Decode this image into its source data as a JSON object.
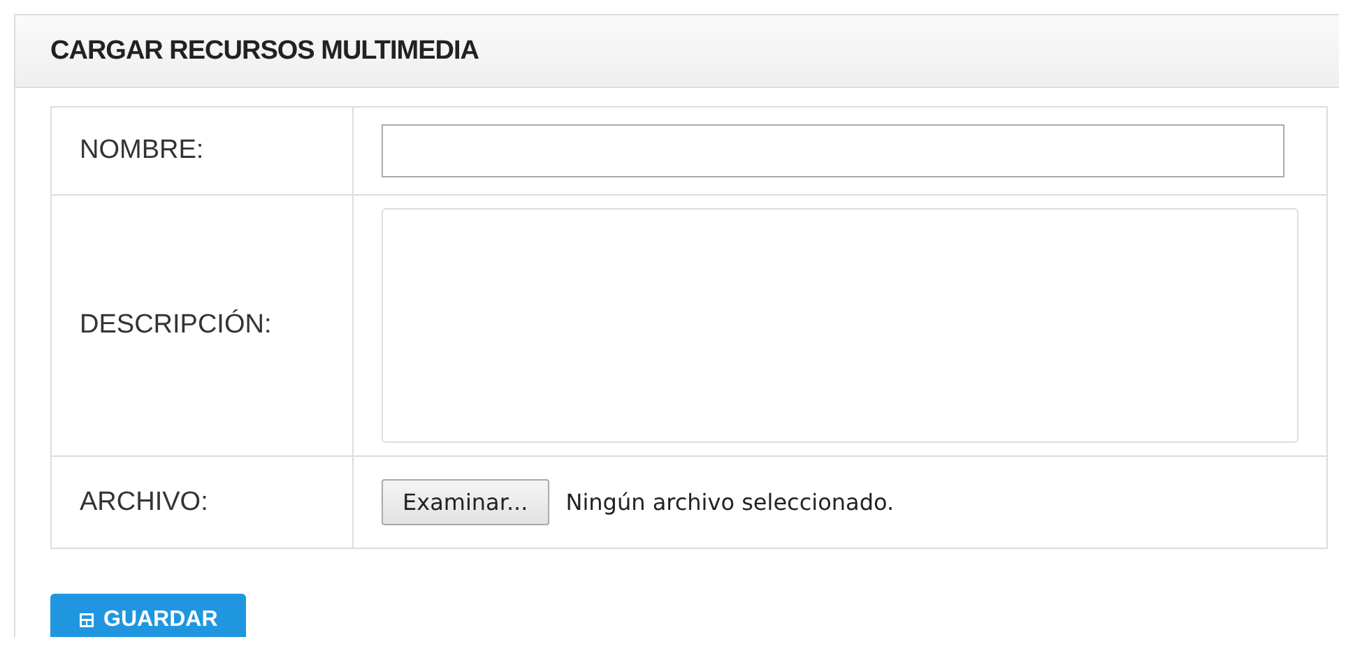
{
  "panel": {
    "title": "CARGAR RECURSOS MULTIMEDIA"
  },
  "fields": [
    {
      "kind": "text",
      "label": "NOMBRE:"
    },
    {
      "kind": "textarea",
      "label": "DESCRIPCIÓN:"
    },
    {
      "kind": "file",
      "label": "ARCHIVO:",
      "button": "Examinar...",
      "status": "Ningún archivo seleccionado."
    }
  ],
  "save_button": {
    "label": "GUARDAR"
  }
}
